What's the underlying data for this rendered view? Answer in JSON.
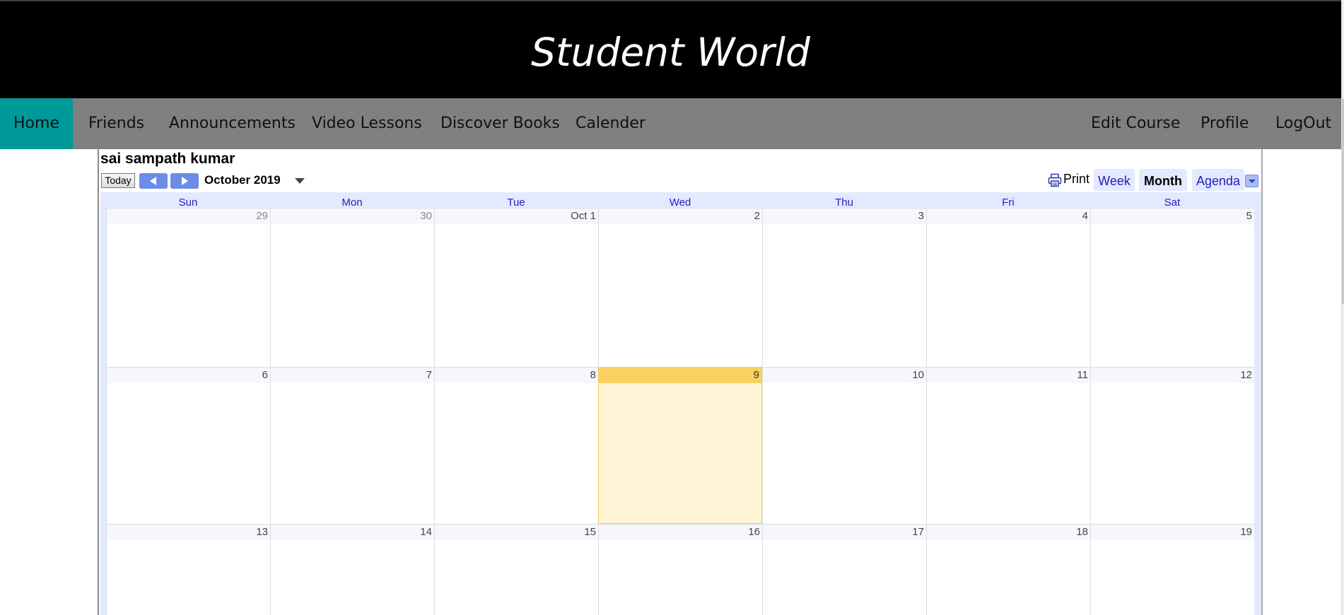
{
  "site": {
    "title": "Student World"
  },
  "nav": {
    "left": [
      {
        "label": "Home",
        "active": true
      },
      {
        "label": "Friends"
      },
      {
        "label": "Announcements"
      },
      {
        "label": "Video Lessons"
      },
      {
        "label": "Discover Books"
      },
      {
        "label": "Calender"
      }
    ],
    "right": [
      {
        "label": "Edit Course"
      },
      {
        "label": "Profile"
      },
      {
        "label": "LogOut"
      }
    ]
  },
  "colors": {
    "nav_active": "#009999",
    "nav_bg": "#808080",
    "header_bg": "#000000",
    "today_highlight": "#f9d160",
    "calendar_accent": "#6b8de8"
  },
  "calendar": {
    "owner": "sai sampath kumar",
    "today_button": "Today",
    "prev_icon": "triangle-left-icon",
    "next_icon": "triangle-right-icon",
    "current_period": "October 2019",
    "print_label": "Print",
    "print_icon": "printer-icon",
    "tabs": {
      "week": "Week",
      "month": "Month",
      "agenda": "Agenda",
      "selected": "Month"
    },
    "weekdays": [
      "Sun",
      "Mon",
      "Tue",
      "Wed",
      "Thu",
      "Fri",
      "Sat"
    ],
    "today": "9",
    "weeks": [
      [
        {
          "label": "29",
          "other": true
        },
        {
          "label": "30",
          "other": true
        },
        {
          "label": "Oct 1"
        },
        {
          "label": "2"
        },
        {
          "label": "3"
        },
        {
          "label": "4"
        },
        {
          "label": "5"
        }
      ],
      [
        {
          "label": "6"
        },
        {
          "label": "7"
        },
        {
          "label": "8"
        },
        {
          "label": "9",
          "today": true
        },
        {
          "label": "10"
        },
        {
          "label": "11"
        },
        {
          "label": "12"
        }
      ],
      [
        {
          "label": "13"
        },
        {
          "label": "14"
        },
        {
          "label": "15"
        },
        {
          "label": "16"
        },
        {
          "label": "17"
        },
        {
          "label": "18"
        },
        {
          "label": "19"
        }
      ]
    ]
  }
}
